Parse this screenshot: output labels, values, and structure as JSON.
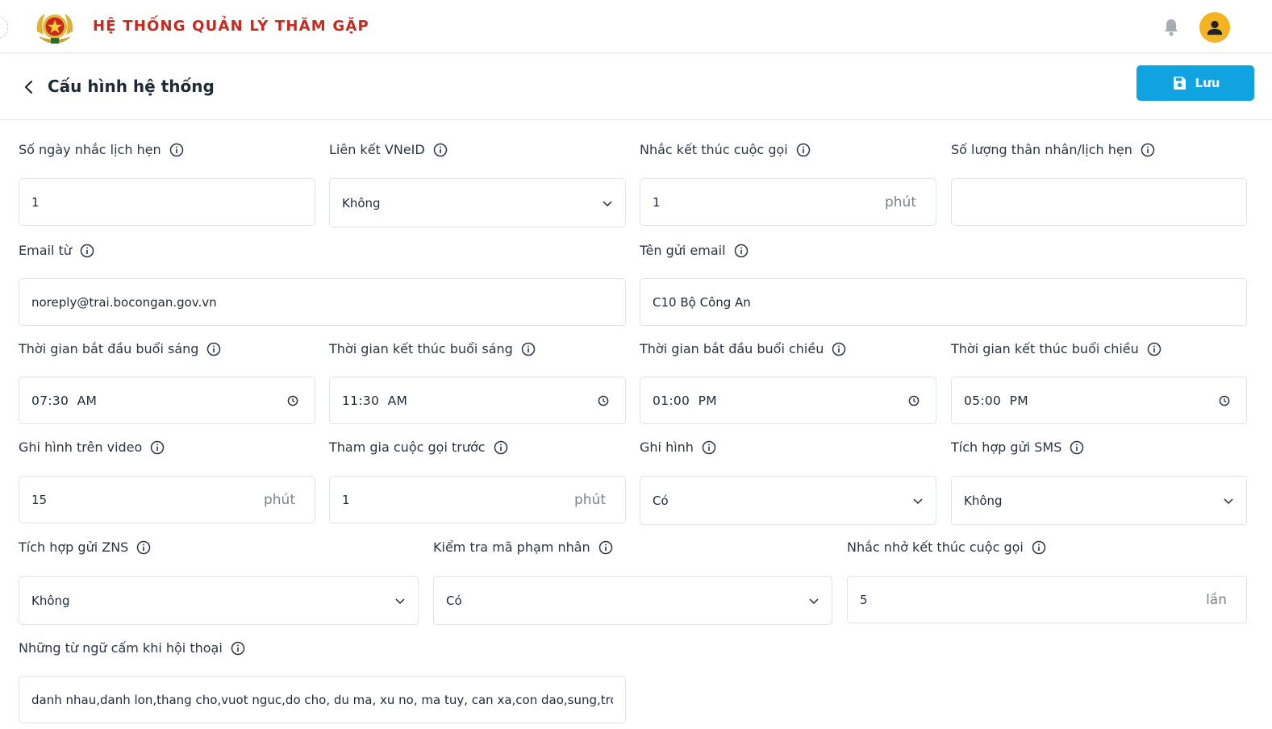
{
  "header": {
    "app_title": "HỆ THỐNG QUẢN LÝ THĂM GẶP",
    "logo_icon": "police-emblem-icon",
    "notification_icon": "bell-icon",
    "avatar_icon": "user-icon"
  },
  "subheader": {
    "title": "Cấu hình hệ thống",
    "save_label": "Lưu"
  },
  "fields": {
    "reminder_days": {
      "label": "Số ngày nhắc lịch hẹn",
      "value": "1"
    },
    "vneid_link": {
      "label": "Liên kết VNeID",
      "value": "Không"
    },
    "end_call_reminder": {
      "label": "Nhắc kết thúc cuộc gọi",
      "value": "1",
      "unit": "phút"
    },
    "relatives_per_appointment": {
      "label": "Số lượng thân nhân/lịch hẹn",
      "value": ""
    },
    "email_from": {
      "label": "Email từ",
      "value": "noreply@trai.bocongan.gov.vn"
    },
    "email_sender_name": {
      "label": "Tên gửi email",
      "value": "C10 Bộ Công An"
    },
    "morning_start": {
      "label": "Thời gian bắt đầu buổi sáng",
      "value": "07:30  AM"
    },
    "morning_end": {
      "label": "Thời gian kết thúc buổi sáng",
      "value": "11:30  AM"
    },
    "afternoon_start": {
      "label": "Thời gian bắt đầu buổi chiều",
      "value": "01:00  PM"
    },
    "afternoon_end": {
      "label": "Thời gian kết thúc buổi chiều",
      "value": "05:00  PM"
    },
    "video_recording": {
      "label": "Ghi hình trên video",
      "value": "15",
      "unit": "phút"
    },
    "join_call_before": {
      "label": "Tham gia cuộc gọi trước",
      "value": "1",
      "unit": "phút"
    },
    "recording": {
      "label": "Ghi hình",
      "value": "Có"
    },
    "sms_integration": {
      "label": "Tích hợp gửi SMS",
      "value": "Không"
    },
    "zns_integration": {
      "label": "Tích hợp gửi ZNS",
      "value": "Không"
    },
    "inmate_code_check": {
      "label": "Kiểm tra mã phạm nhân",
      "value": "Có"
    },
    "end_call_reminder_times": {
      "label": "Nhắc nhở kết thúc cuộc gọi",
      "value": "5",
      "unit": "lần"
    },
    "forbidden_words": {
      "label": "Những từ ngữ cấm khi hội thoại",
      "value": "danh nhau,danh lon,thang cho,vuot nguc,do cho, du ma, xu no, ma tuy, can xa,con dao,sung,tron trai,"
    }
  }
}
